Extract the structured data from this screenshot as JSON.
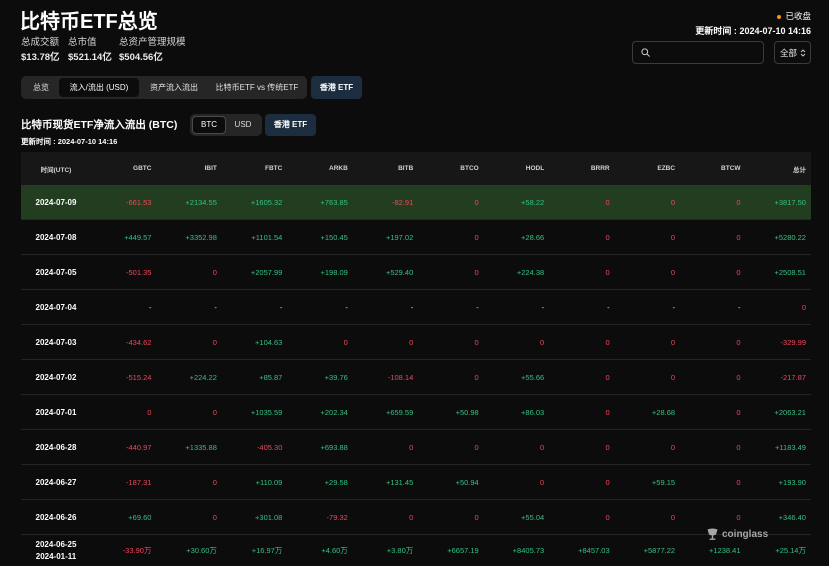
{
  "header": {
    "title": "比特币ETF总览",
    "stats": [
      {
        "label": "总成交额",
        "value": "$13.78亿"
      },
      {
        "label": "总市值",
        "value": "$521.14亿"
      },
      {
        "label": "总资产管理规模",
        "value": "$504.56亿"
      }
    ],
    "status": {
      "label": "已收盘"
    },
    "updated": {
      "label": "更新时间 :",
      "value": "2024-07-10 14:16"
    },
    "search": {
      "value": "",
      "icon": "search-icon"
    },
    "filter": {
      "selected": "全部",
      "icon": "chevron-up-down-icon"
    }
  },
  "nav": {
    "tabs": [
      {
        "label": "总览",
        "selected": false
      },
      {
        "label": "流入/流出 (USD)",
        "selected": true
      },
      {
        "label": "资产流入流出",
        "selected": false
      },
      {
        "label": "比特币ETF vs 传统ETF",
        "selected": false
      }
    ],
    "hk_button": "香港 ETF"
  },
  "section": {
    "title": "比特币现货ETF净流入流出 (BTC)",
    "unit_options": [
      {
        "label": "BTC",
        "selected": true
      },
      {
        "label": "USD",
        "selected": false
      }
    ],
    "hk_button": "香港 ETF",
    "updated": {
      "label": "更新时间 :",
      "value": "2024-07-10 14:16"
    }
  },
  "table": {
    "columns": [
      "时间(UTC)",
      "GBTC",
      "IBIT",
      "FBTC",
      "ARKB",
      "BITB",
      "BTCO",
      "HODL",
      "BRRR",
      "EZBC",
      "BTCW",
      "总计"
    ],
    "rows": [
      {
        "date": "2024-07-09",
        "highlighted": true,
        "values": [
          "-661.53",
          "+2134.55",
          "+1605.32",
          "+763.85",
          "-82.91",
          "0",
          "+58.22",
          "0",
          "0",
          "0",
          "+3817.50"
        ]
      },
      {
        "date": "2024-07-08",
        "highlighted": false,
        "values": [
          "+449.57",
          "+3352.98",
          "+1101.54",
          "+150.45",
          "+197.02",
          "0",
          "+28.66",
          "0",
          "0",
          "0",
          "+5280.22"
        ]
      },
      {
        "date": "2024-07-05",
        "highlighted": false,
        "values": [
          "-501.35",
          "0",
          "+2057.99",
          "+198.09",
          "+529.40",
          "0",
          "+224.38",
          "0",
          "0",
          "0",
          "+2508.51"
        ]
      },
      {
        "date": "2024-07-04",
        "highlighted": false,
        "values": [
          "-",
          "-",
          "-",
          "-",
          "-",
          "-",
          "-",
          "-",
          "-",
          "-",
          "0"
        ]
      },
      {
        "date": "2024-07-03",
        "highlighted": false,
        "values": [
          "-434.62",
          "0",
          "+104.63",
          "0",
          "0",
          "0",
          "0",
          "0",
          "0",
          "0",
          "-329.99"
        ]
      },
      {
        "date": "2024-07-02",
        "highlighted": false,
        "values": [
          "-515.24",
          "+224.22",
          "+85.87",
          "+39.76",
          "-108.14",
          "0",
          "+55.66",
          "0",
          "0",
          "0",
          "-217.87"
        ]
      },
      {
        "date": "2024-07-01",
        "highlighted": false,
        "values": [
          "0",
          "0",
          "+1035.59",
          "+202.34",
          "+659.59",
          "+50.98",
          "+86.03",
          "0",
          "+28.68",
          "0",
          "+2063.21"
        ]
      },
      {
        "date": "2024-06-28",
        "highlighted": false,
        "values": [
          "-440.97",
          "+1335.88",
          "-405.30",
          "+693.88",
          "0",
          "0",
          "0",
          "0",
          "0",
          "0",
          "+1183.49"
        ]
      },
      {
        "date": "2024-06-27",
        "highlighted": false,
        "values": [
          "-187.31",
          "0",
          "+110.09",
          "+29.58",
          "+131.45",
          "+50.94",
          "0",
          "0",
          "+59.15",
          "0",
          "+193.90"
        ]
      },
      {
        "date": "2024-06-26",
        "highlighted": false,
        "values": [
          "+69.60",
          "0",
          "+301.08",
          "-79.32",
          "0",
          "0",
          "+55.04",
          "0",
          "0",
          "0",
          "+346.40"
        ]
      }
    ],
    "summary": {
      "dates": [
        "2024-06-25",
        "2024-01-11"
      ],
      "values": [
        "-33.90万",
        "+30.60万",
        "+16.97万",
        "+4.60万",
        "+3.80万",
        "+6657.19",
        "+8405.73",
        "+8457.03",
        "+5877.22",
        "+1238.41",
        "+25.14万"
      ]
    }
  },
  "watermark": {
    "text": "coinglass",
    "icon": "coinglass-logo-icon"
  },
  "colors": {
    "positive": "#35c184",
    "negative": "#f0475b",
    "highlight_row": "#223d1f",
    "status_dot": "#f7931a",
    "hk_button": "#1d2d40"
  }
}
